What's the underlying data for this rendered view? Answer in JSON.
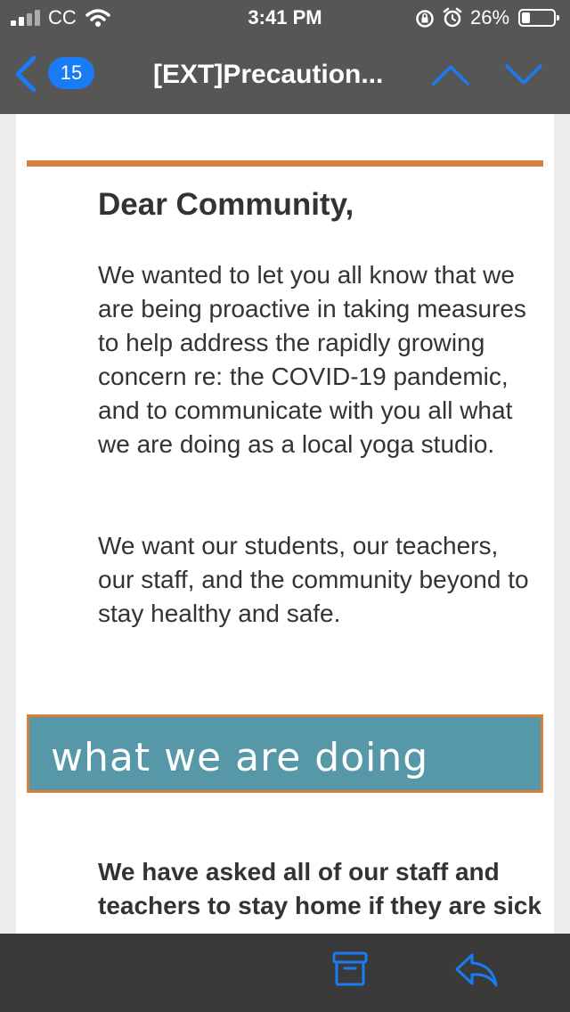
{
  "status_bar": {
    "carrier": "CC",
    "time": "3:41 PM",
    "battery_percent": "26%",
    "battery_level": 0.26
  },
  "nav": {
    "unread_count": "15",
    "subject": "[EXT]Precaution..."
  },
  "email": {
    "greeting": "Dear Community,",
    "paragraph1": "We wanted to let you all know that we are being proactive in taking measures to help address the rapidly growing concern re: the COVID-19 pandemic, and to communicate with you all what we are doing as a local yoga studio.",
    "paragraph2": "We want our students, our teachers, our staff, and the community beyond to stay healthy and safe.",
    "section_heading": "what we are doing",
    "paragraph3": "We have asked all of our staff and teachers to stay home if they are sick"
  },
  "colors": {
    "accent_orange": "#d97f3d",
    "banner_teal": "#5698a8",
    "ios_blue": "#1a7cf5",
    "chrome_gray": "#565656"
  },
  "icons": {
    "back": "chevron-left-icon",
    "up": "chevron-up-icon",
    "down": "chevron-down-icon",
    "archive": "archive-box-icon",
    "reply": "reply-arrow-icon"
  }
}
